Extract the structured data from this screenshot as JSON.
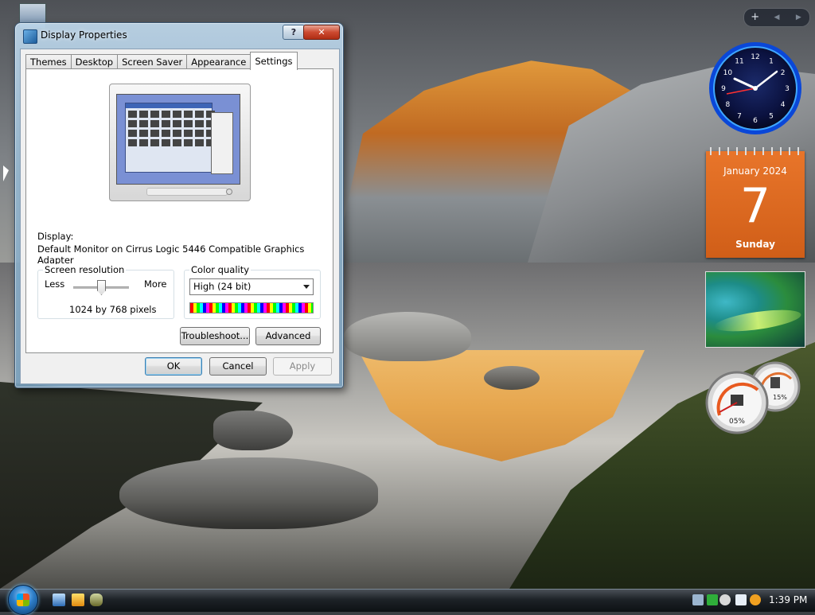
{
  "window": {
    "title": "Display Properties",
    "help_label": "?",
    "close_label": "✕"
  },
  "tabs": [
    {
      "label": "Themes"
    },
    {
      "label": "Desktop"
    },
    {
      "label": "Screen Saver"
    },
    {
      "label": "Appearance"
    },
    {
      "label": "Settings",
      "active": true
    }
  ],
  "settings": {
    "display_label": "Display:",
    "display_value": "Default Monitor on Cirrus Logic 5446 Compatible Graphics Adapter",
    "resolution": {
      "group_label": "Screen resolution",
      "less_label": "Less",
      "more_label": "More",
      "value_text": "1024 by 768 pixels",
      "slider_level": 0.5
    },
    "color_quality": {
      "group_label": "Color quality",
      "selected": "High (24 bit)"
    },
    "troubleshoot_label": "Troubleshoot...",
    "advanced_label": "Advanced"
  },
  "footer": {
    "ok_label": "OK",
    "cancel_label": "Cancel",
    "apply_label": "Apply"
  },
  "gadgets": {
    "sidebar_controls": {
      "add_label": "+",
      "prev_label": "◀",
      "next_label": "▶"
    },
    "clock": {
      "numerals": [
        "12",
        "1",
        "2",
        "3",
        "4",
        "5",
        "6",
        "7",
        "8",
        "9",
        "10",
        "11"
      ]
    },
    "calendar": {
      "month_year": "January 2024",
      "day": "7",
      "weekday": "Sunday"
    },
    "meters": {
      "cpu_percent": "05%",
      "memory_percent": "15%"
    }
  },
  "taskbar": {
    "time": "1:39 PM"
  },
  "colors": {
    "accent": "#3c7fb1",
    "calendar": "#e06a22",
    "taskbar": "#1d2227"
  }
}
